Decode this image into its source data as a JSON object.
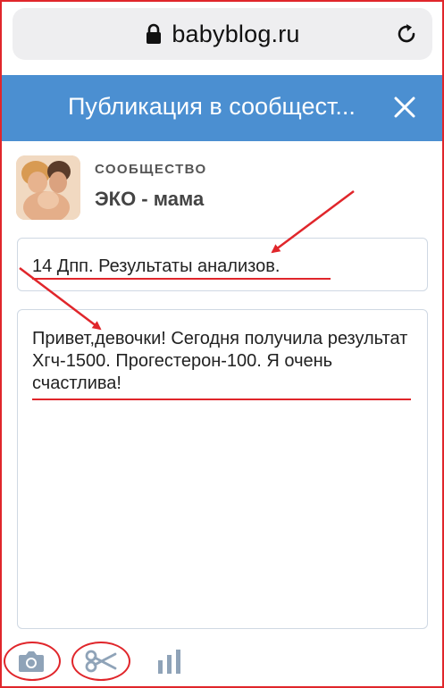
{
  "browser": {
    "url": "babyblog.ru"
  },
  "header": {
    "title": "Публикация в сообщест..."
  },
  "community": {
    "caption": "СООБЩЕСТВО",
    "name": "ЭКО - мама"
  },
  "post": {
    "title_value": "14 Дпп. Результаты анализов.",
    "body_value": "Привет,девочки! Сегодня получила результат Хгч-1500. Прогестерон-100. Я очень счастлива!"
  },
  "toolbar": {
    "icons": [
      "camera-icon",
      "scissors-icon",
      "bar-chart-icon"
    ]
  },
  "colors": {
    "header_bg": "#4b8fd1",
    "annotation": "#e0262b",
    "icon": "#8fa3b8"
  }
}
